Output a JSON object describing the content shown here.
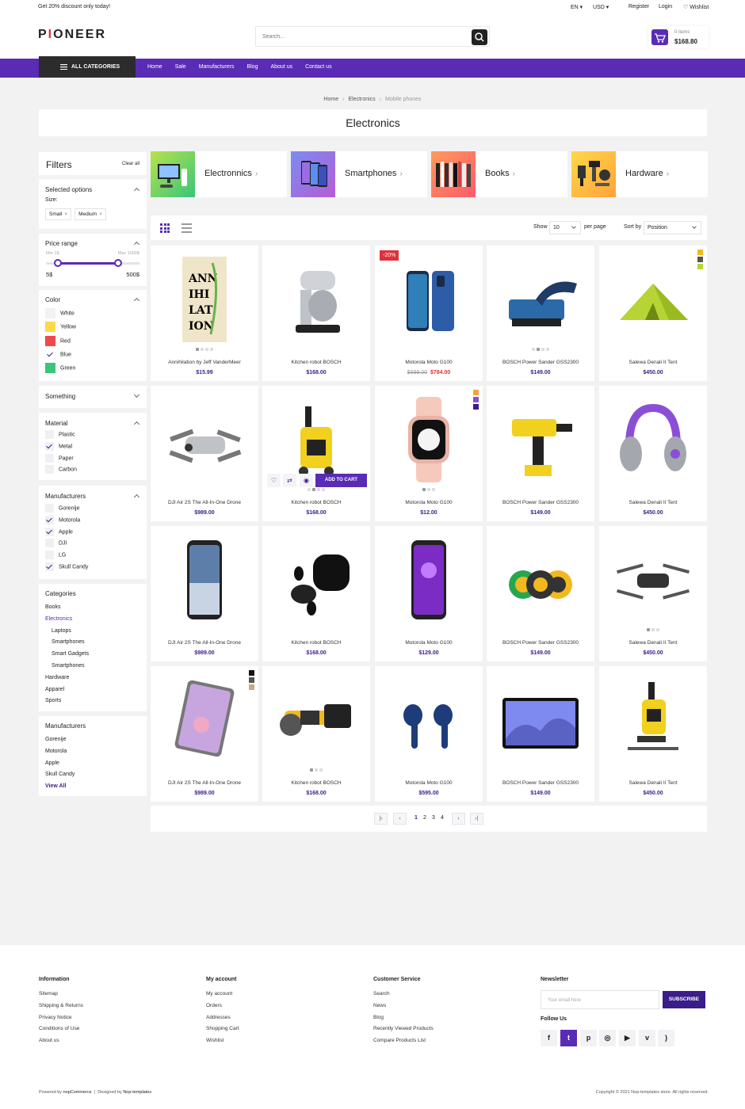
{
  "topbar": {
    "promo": "Get 20% discount only today!",
    "lang": "EN",
    "currency": "USD",
    "register": "Register",
    "login": "Login",
    "wishlist": "Wishlist"
  },
  "header": {
    "logo_a": "P",
    "logo_b": "I",
    "logo_c": "ONEER",
    "search_placeholder": "Search...",
    "cart_items": "0 items",
    "cart_total": "$168.80"
  },
  "nav": {
    "all_categories": "ALL CATEGORIES",
    "links": [
      "Home",
      "Sale",
      "Manufacturers",
      "Blog",
      "About us",
      "Contact us"
    ]
  },
  "breadcrumb": [
    "Home",
    "Electronics",
    "Mobile phones"
  ],
  "page_title": "Electronics",
  "filters": {
    "title": "Filters",
    "clear_all": "Clear all",
    "selected_options": "Selected options",
    "size_label": "Size:",
    "tags": [
      "Small",
      "Medium"
    ],
    "price_range": "Price range",
    "min_label": "Min 1$",
    "max_label": "Max 1000$",
    "min_val": "5$",
    "max_val": "500$",
    "color_title": "Color",
    "colors": [
      {
        "name": "White",
        "hex": "#f2f2f4",
        "checked": false
      },
      {
        "name": "Yellow",
        "hex": "#ffd84a",
        "checked": false
      },
      {
        "name": "Red",
        "hex": "#ee4a4a",
        "checked": false
      },
      {
        "name": "Blue",
        "hex": "#ffffff",
        "checked": true
      },
      {
        "name": "Green",
        "hex": "#39c57a",
        "checked": false
      }
    ],
    "something": "Something",
    "material_title": "Material",
    "materials": [
      {
        "name": "Plastic",
        "checked": false
      },
      {
        "name": "Metal",
        "checked": true
      },
      {
        "name": "Paper",
        "checked": false
      },
      {
        "name": "Carbon",
        "checked": false
      }
    ],
    "manufacturers_title": "Manufacturers",
    "manufacturers": [
      {
        "name": "Gorenije",
        "checked": false
      },
      {
        "name": "Motorola",
        "checked": true
      },
      {
        "name": "Apple",
        "checked": true
      },
      {
        "name": "DJI",
        "checked": false
      },
      {
        "name": "LG",
        "checked": false
      },
      {
        "name": "Skull Candy",
        "checked": true
      }
    ]
  },
  "categories_box": {
    "title": "Categories",
    "items": [
      "Books",
      "Electronics",
      "Laptops",
      "Smartphones",
      "Smart Gadgets",
      "Smartphones",
      "Hardware",
      "Apparel",
      "Sports"
    ]
  },
  "manufacturers_box": {
    "title": "Manufacturers",
    "items": [
      "Gorenije",
      "Motorola",
      "Apple",
      "Skull Candy"
    ],
    "view_all": "View All"
  },
  "cat_cards": [
    "Electronnics",
    "Smartphones",
    "Books",
    "Hardware"
  ],
  "toolbar": {
    "show": "Show",
    "show_value": "10",
    "per_page": "per page",
    "sort_by": "Sort by",
    "sort_value": "Position"
  },
  "products": [
    {
      "name": "Annihilation by Jeff VanderMeer",
      "price": "$15.99"
    },
    {
      "name": "Kitchen robot BOSCH",
      "price": "$168.00"
    },
    {
      "name": "Motorola Moto G100",
      "old_price": "$899.00",
      "price": "$784.00",
      "badge": "-20%"
    },
    {
      "name": "BOSCH Power Sander GSS2300",
      "price": "$149.00"
    },
    {
      "name": "Salewa Denali II Tent",
      "price": "$450.00"
    },
    {
      "name": "DJI Air 2S The All-In-One Drone",
      "price": "$989.00"
    },
    {
      "name": "Kitchen robot BOSCH",
      "price": "$168.00"
    },
    {
      "name": "Motorola Moto G100",
      "price": "$12.00"
    },
    {
      "name": "BOSCH Power Sander GSS2300",
      "price": "$149.00"
    },
    {
      "name": "Salewa Denali II Tent",
      "price": "$450.00"
    },
    {
      "name": "DJI Air 2S The All-In-One Drone",
      "price": "$989.00"
    },
    {
      "name": "Kitchen robot BOSCH",
      "price": "$168.00"
    },
    {
      "name": "Motorola Moto G100",
      "price": "$129.00"
    },
    {
      "name": "BOSCH Power Sander GSS2300",
      "price": "$149.00"
    },
    {
      "name": "Salewa Denali II Tent",
      "price": "$450.00"
    },
    {
      "name": "DJI Air 2S The All-In-One Drone",
      "price": "$989.00"
    },
    {
      "name": "Kitchen robot BOSCH",
      "price": "$168.00"
    },
    {
      "name": "Motorola Moto G100",
      "price": "$595.00"
    },
    {
      "name": "BOSCH Power Sander GSS2300",
      "price": "$149.00"
    },
    {
      "name": "Salewa Denali II Tent",
      "price": "$450.00"
    }
  ],
  "add_to_cart": "ADD TO CART",
  "pager": {
    "pages": [
      "1",
      "2",
      "3",
      "4"
    ]
  },
  "footer": {
    "information": {
      "title": "Information",
      "links": [
        "Sitemap",
        "Shipping & Returns",
        "Privacy Notice",
        "Conditions of Use",
        "About us"
      ]
    },
    "account": {
      "title": "My account",
      "links": [
        "My account",
        "Orders",
        "Addresses",
        "Shopping Cart",
        "Wishlist"
      ]
    },
    "service": {
      "title": "Customer Service",
      "links": [
        "Search",
        "News",
        "Blog",
        "Recently Viewed Products",
        "Compare Products List"
      ]
    },
    "newsletter": {
      "title": "Newsletter",
      "placeholder": "Your email here",
      "button": "SUBSCRIBE",
      "follow": "Follow Us"
    },
    "powered_a": "Powered by",
    "powered_b": "nopCommerce",
    "designed_a": "Designed by",
    "designed_b": "Nop-templates",
    "copyright": "Copyright © 2021 Nop-templates store. All rights reserved."
  },
  "colors": {
    "accent": "#5a2bb5",
    "dark": "#2c2c2c",
    "sale": "#e0303a",
    "price": "#3a1d8a"
  }
}
